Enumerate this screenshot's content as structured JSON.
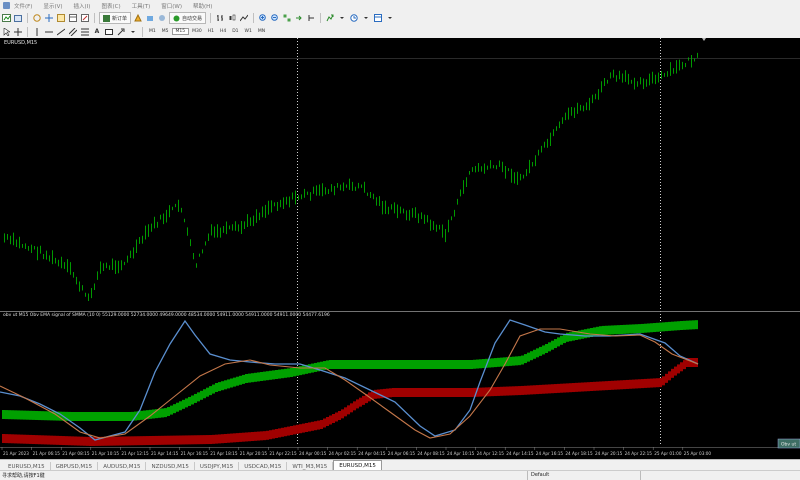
{
  "menu": [
    "文件(F)",
    "显示(V)",
    "插入(I)",
    "图表(C)",
    "工具(T)",
    "窗口(W)",
    "帮助(H)"
  ],
  "toolbar": {
    "new_order": "新订单",
    "autotrading": "自动交易",
    "timeframes": [
      "M1",
      "M5",
      "M15",
      "M30",
      "H1",
      "H4",
      "D1",
      "W1",
      "MN"
    ]
  },
  "chart": {
    "window_title": "EURUSD,M15",
    "price_color": "#00c000",
    "indicator_label": "obv ut M15 Obv EMA signal of SMMA (10 0) 55129.0000 52734.0000 49649.0000 48534.0000 54911.0000 54911.0000 54911.0000 54477.6196",
    "indicator_badge": "Obv ut",
    "time_labels": [
      "21 Apr 2023",
      "21 Apr 06:15",
      "21 Apr 08:15",
      "21 Apr 10:15",
      "21 Apr 12:15",
      "21 Apr 14:15",
      "21 Apr 16:15",
      "21 Apr 18:15",
      "21 Apr 20:15",
      "21 Apr 22:15",
      "24 Apr 00:15",
      "24 Apr 02:15",
      "24 Apr 04:15",
      "24 Apr 06:15",
      "24 Apr 08:15",
      "24 Apr 10:15",
      "24 Apr 12:15",
      "24 Apr 14:15",
      "24 Apr 16:15",
      "24 Apr 18:15",
      "24 Apr 20:15",
      "24 Apr 22:15",
      "25 Apr 01:00",
      "25 Apr 03:00"
    ],
    "colors": {
      "bull_band": "#00a000",
      "bear_band": "#a00000",
      "obv_line": "#5a8fd0",
      "signal_line": "#c4774a",
      "signal_alt": "#c9c9c9"
    }
  },
  "tabs": [
    "EURUSD,M15",
    "GBPUSD,M15",
    "AUDUSD,M15",
    "NZDUSD,M15",
    "USDJPY,M15",
    "USDCAD,M15",
    "WTI_M3,M15",
    "EURUSD,M15"
  ],
  "active_tab_index": 7,
  "status": {
    "help_text": "寻求帮助,请按F1键",
    "profile": "Default"
  }
}
